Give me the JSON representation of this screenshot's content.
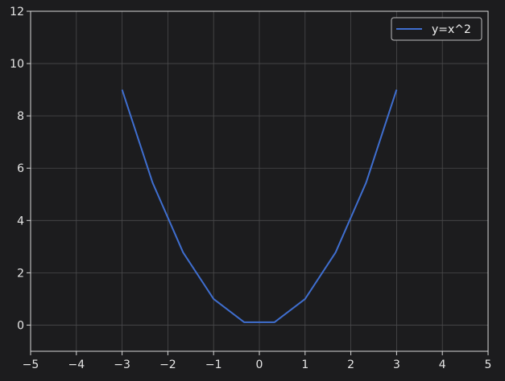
{
  "chart_data": {
    "type": "line",
    "x": [
      -3,
      -2.3333,
      -1.6667,
      -1,
      -0.3333,
      0.3333,
      1,
      1.6667,
      2.3333,
      3
    ],
    "series": [
      {
        "name": "y=x^2",
        "values": [
          9,
          5.4444,
          2.7778,
          1,
          0.1111,
          0.1111,
          1,
          2.7778,
          5.4444,
          9
        ]
      }
    ],
    "xlim": [
      -5,
      5
    ],
    "ylim": [
      -1,
      12
    ],
    "xticks": [
      -5,
      -4,
      -3,
      -2,
      -1,
      0,
      1,
      2,
      3,
      4,
      5
    ],
    "xtick_labels": [
      "−5",
      "−4",
      "−3",
      "−2",
      "−1",
      "0",
      "1",
      "2",
      "3",
      "4",
      "5"
    ],
    "yticks": [
      0,
      2,
      4,
      6,
      8,
      10,
      12
    ],
    "ytick_labels": [
      "0",
      "2",
      "4",
      "6",
      "8",
      "10",
      "12"
    ],
    "grid": true,
    "legend_position": "top-right",
    "colors": {
      "background": "#1c1c1e",
      "plot_background": "#1c1c1e",
      "line": "#3f6ecf",
      "grid": "#4a4a4c",
      "axis": "#d8d8d8",
      "legend_border": "#bdbdbd"
    }
  }
}
